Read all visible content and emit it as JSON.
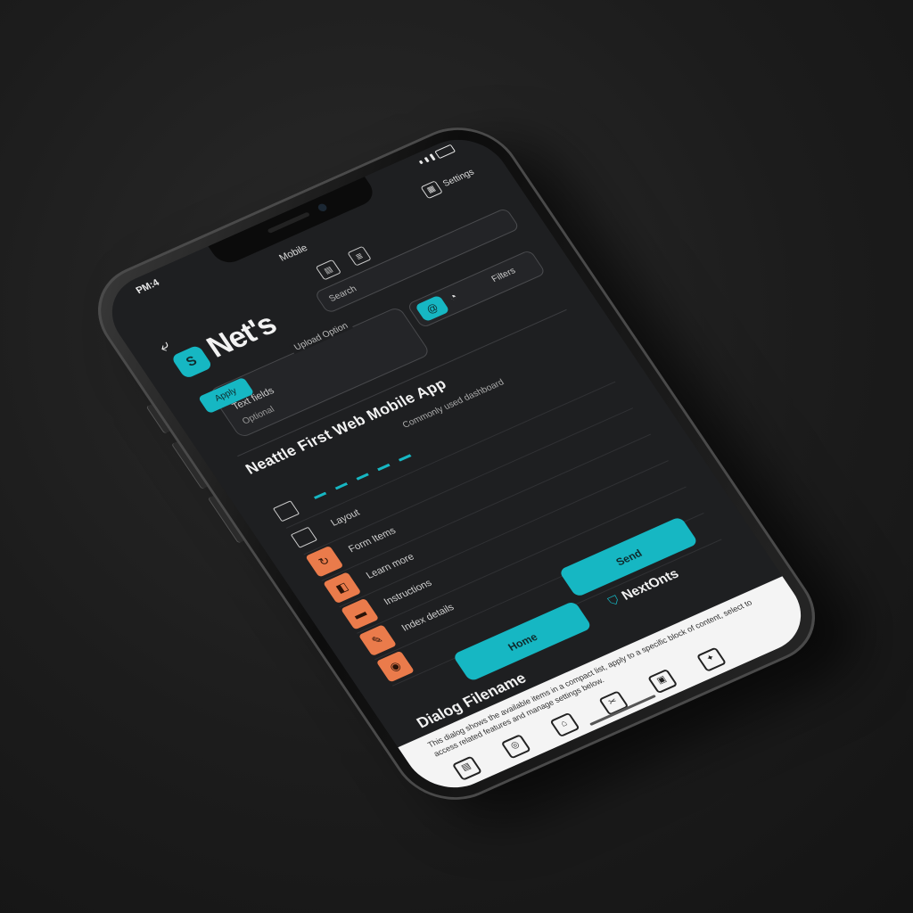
{
  "status": {
    "time": "PM:4"
  },
  "topbar": {
    "center": "Mobile",
    "tools": [
      "Apps",
      "Menu",
      "Settings"
    ]
  },
  "header": {
    "back": "⤶",
    "logo_badge": "S",
    "title": "Net's",
    "tool_1": "▤",
    "tool_2": "≣",
    "search_placeholder": "Search"
  },
  "filters": {
    "chip": "Apply",
    "field_label": "Upload Option",
    "field_value": "Text fields",
    "field_note": "Optional",
    "toggle_on": "@",
    "toggle_off": "◔",
    "toggle_label": "Filters"
  },
  "main": {
    "section_title": "Neattle First Web Mobile App",
    "sub_caption": "Commonly used dashboard",
    "list": [
      {
        "label": "Layout"
      },
      {
        "label": "Form Items"
      },
      {
        "label": "Learn more"
      },
      {
        "label": "Instructions"
      },
      {
        "label": "Index details"
      }
    ]
  },
  "buttons": {
    "primary": "Send",
    "secondary": "Home"
  },
  "brand": {
    "icon": "⛉",
    "text": "NextOnts"
  },
  "drawer": {
    "title": "Dialog Filename",
    "text": "This dialog shows the available items in a compact list, apply to a specific block of content, select to access related features and manage settings below."
  },
  "nav": [
    "▤",
    "◎",
    "⌂",
    "✂",
    "▣",
    "✦"
  ],
  "colors": {
    "accent": "#16b7c3",
    "orange": "#ea7b4b",
    "background": "#1e1f21",
    "panel": "#f4f4f4"
  }
}
